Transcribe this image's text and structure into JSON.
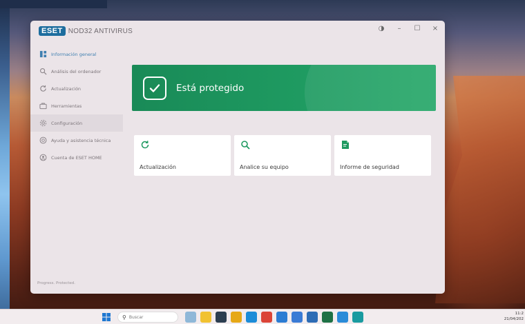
{
  "app": {
    "logo_brand": "ESET",
    "logo_product": "NOD32 ANTIVIRUS",
    "controls": {
      "theme": "◑",
      "minimize": "–",
      "maximize": "☐",
      "close": "×"
    }
  },
  "sidebar": {
    "items": [
      {
        "label": "Información general",
        "icon": "overview-icon",
        "active": true
      },
      {
        "label": "Análisis del ordenador",
        "icon": "search-icon"
      },
      {
        "label": "Actualización",
        "icon": "refresh-icon"
      },
      {
        "label": "Herramientas",
        "icon": "briefcase-icon"
      },
      {
        "label": "Configuración",
        "icon": "gear-icon",
        "hover": true
      },
      {
        "label": "Ayuda y asistencia técnica",
        "icon": "help-icon"
      },
      {
        "label": "Cuenta de ESET HOME",
        "icon": "account-icon"
      }
    ],
    "footer": "Progress. Protected."
  },
  "status": {
    "text": "Está protegido",
    "color": "#1e9960"
  },
  "tiles": [
    {
      "label": "Actualización",
      "icon": "refresh-icon"
    },
    {
      "label": "Analice su equipo",
      "icon": "search-icon"
    },
    {
      "label": "Informe de seguridad",
      "icon": "report-icon"
    }
  ],
  "taskbar": {
    "search_placeholder": "Buscar",
    "clock_time": "11:2",
    "clock_date": "21/04/202",
    "apps": [
      {
        "name": "landscape-app-icon",
        "color": "#8fb8d8"
      },
      {
        "name": "file-explorer-icon",
        "color": "#f1c232"
      },
      {
        "name": "taskview-icon",
        "color": "#2c3e50"
      },
      {
        "name": "folder-icon",
        "color": "#e6a817"
      },
      {
        "name": "edge-icon",
        "color": "#1c8cd8"
      },
      {
        "name": "chrome-icon",
        "color": "#db4437"
      },
      {
        "name": "store-icon",
        "color": "#2b7cd3"
      },
      {
        "name": "app-icon-1",
        "color": "#3a7bd5"
      },
      {
        "name": "mail-icon",
        "color": "#2d6cb5"
      },
      {
        "name": "excel-icon",
        "color": "#1e7145"
      },
      {
        "name": "photos-icon",
        "color": "#2a8bd8"
      },
      {
        "name": "eset-app-icon",
        "color": "#1a9ba0"
      }
    ]
  }
}
